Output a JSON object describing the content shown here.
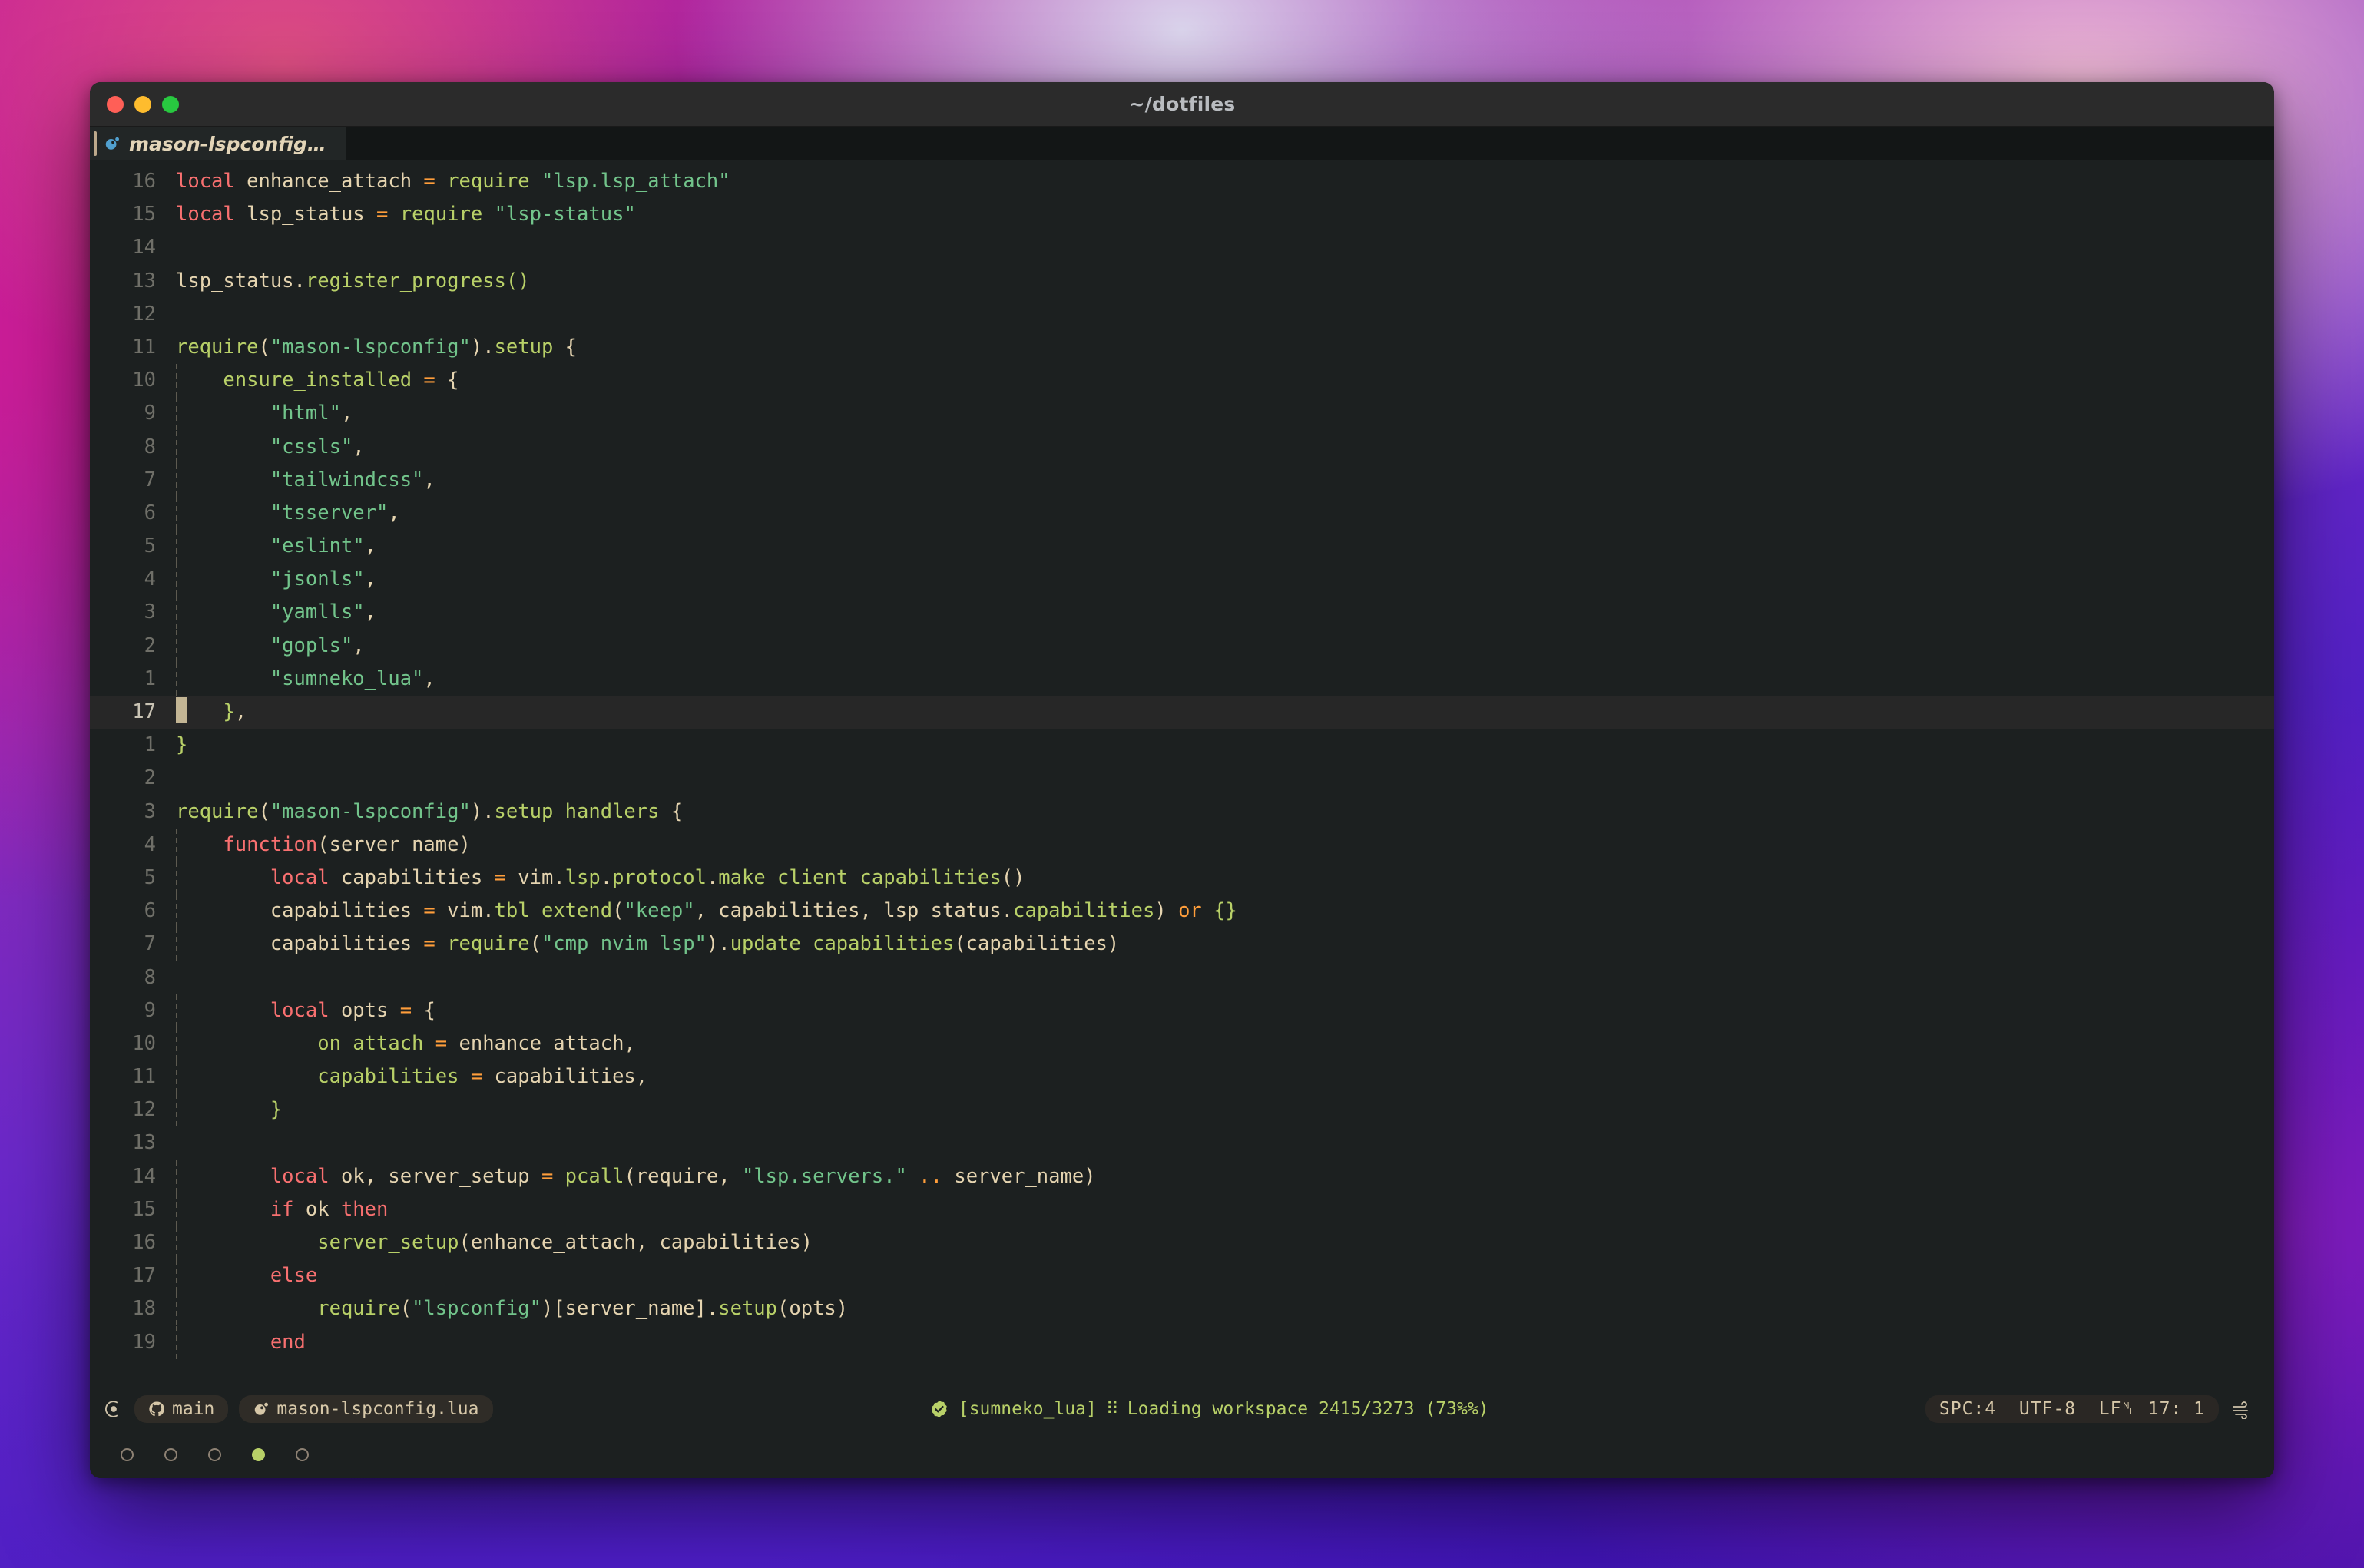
{
  "window": {
    "title": "~/dotfiles",
    "traffic_lights": [
      "close-button",
      "minimize-button",
      "zoom-button"
    ]
  },
  "tabline": {
    "tabs": [
      {
        "label": "mason-lspconfig…",
        "icon": "lua-icon",
        "active": true
      }
    ]
  },
  "editor": {
    "filetype": "lua",
    "cursor_line_number": "17",
    "lines": [
      {
        "num": "16",
        "indent": 0,
        "cursor": false,
        "tokens": [
          {
            "t": "local ",
            "c": "kw"
          },
          {
            "t": "enhance_attach ",
            "c": "var"
          },
          {
            "t": "= ",
            "c": "op"
          },
          {
            "t": "require ",
            "c": "fn"
          },
          {
            "t": "\"lsp.lsp_attach\"",
            "c": "str"
          }
        ]
      },
      {
        "num": "15",
        "indent": 0,
        "cursor": false,
        "tokens": [
          {
            "t": "local ",
            "c": "kw"
          },
          {
            "t": "lsp_status ",
            "c": "var"
          },
          {
            "t": "= ",
            "c": "op"
          },
          {
            "t": "require ",
            "c": "fn"
          },
          {
            "t": "\"lsp-status\"",
            "c": "str"
          }
        ]
      },
      {
        "num": "14",
        "indent": 0,
        "cursor": false,
        "tokens": []
      },
      {
        "num": "13",
        "indent": 0,
        "cursor": false,
        "tokens": [
          {
            "t": "lsp_status",
            "c": "var"
          },
          {
            "t": ".",
            "c": "pun"
          },
          {
            "t": "register_progress()",
            "c": "fn"
          }
        ]
      },
      {
        "num": "12",
        "indent": 0,
        "cursor": false,
        "tokens": []
      },
      {
        "num": "11",
        "indent": 0,
        "cursor": false,
        "tokens": [
          {
            "t": "require",
            "c": "fn"
          },
          {
            "t": "(",
            "c": "pun"
          },
          {
            "t": "\"mason-lspconfig\"",
            "c": "str"
          },
          {
            "t": ")",
            "c": "pun"
          },
          {
            "t": ".",
            "c": "pun"
          },
          {
            "t": "setup ",
            "c": "fn"
          },
          {
            "t": "{",
            "c": "pun"
          }
        ]
      },
      {
        "num": "10",
        "indent": 1,
        "cursor": false,
        "tokens": [
          {
            "t": "    ",
            "c": "pun"
          },
          {
            "t": "ensure_installed ",
            "c": "fn"
          },
          {
            "t": "= ",
            "c": "op"
          },
          {
            "t": "{",
            "c": "pun"
          }
        ]
      },
      {
        "num": "9",
        "indent": 2,
        "cursor": false,
        "tokens": [
          {
            "t": "        ",
            "c": "pun"
          },
          {
            "t": "\"html\"",
            "c": "str"
          },
          {
            "t": ",",
            "c": "pun"
          }
        ]
      },
      {
        "num": "8",
        "indent": 2,
        "cursor": false,
        "tokens": [
          {
            "t": "        ",
            "c": "pun"
          },
          {
            "t": "\"cssls\"",
            "c": "str"
          },
          {
            "t": ",",
            "c": "pun"
          }
        ]
      },
      {
        "num": "7",
        "indent": 2,
        "cursor": false,
        "tokens": [
          {
            "t": "        ",
            "c": "pun"
          },
          {
            "t": "\"tailwindcss\"",
            "c": "str"
          },
          {
            "t": ",",
            "c": "pun"
          }
        ]
      },
      {
        "num": "6",
        "indent": 2,
        "cursor": false,
        "tokens": [
          {
            "t": "        ",
            "c": "pun"
          },
          {
            "t": "\"tsserver\"",
            "c": "str"
          },
          {
            "t": ",",
            "c": "pun"
          }
        ]
      },
      {
        "num": "5",
        "indent": 2,
        "cursor": false,
        "tokens": [
          {
            "t": "        ",
            "c": "pun"
          },
          {
            "t": "\"eslint\"",
            "c": "str"
          },
          {
            "t": ",",
            "c": "pun"
          }
        ]
      },
      {
        "num": "4",
        "indent": 2,
        "cursor": false,
        "tokens": [
          {
            "t": "        ",
            "c": "pun"
          },
          {
            "t": "\"jsonls\"",
            "c": "str"
          },
          {
            "t": ",",
            "c": "pun"
          }
        ]
      },
      {
        "num": "3",
        "indent": 2,
        "cursor": false,
        "tokens": [
          {
            "t": "        ",
            "c": "pun"
          },
          {
            "t": "\"yamlls\"",
            "c": "str"
          },
          {
            "t": ",",
            "c": "pun"
          }
        ]
      },
      {
        "num": "2",
        "indent": 2,
        "cursor": false,
        "tokens": [
          {
            "t": "        ",
            "c": "pun"
          },
          {
            "t": "\"gopls\"",
            "c": "str"
          },
          {
            "t": ",",
            "c": "pun"
          }
        ]
      },
      {
        "num": "1",
        "indent": 2,
        "cursor": false,
        "tokens": [
          {
            "t": "        ",
            "c": "pun"
          },
          {
            "t": "\"sumneko_lua\"",
            "c": "str"
          },
          {
            "t": ",",
            "c": "pun"
          }
        ]
      },
      {
        "num": "17",
        "indent": 0,
        "cursor": true,
        "tokens": [
          {
            "t": "   ",
            "c": "pun"
          },
          {
            "t": "}",
            "c": "fn"
          },
          {
            "t": ",",
            "c": "pun"
          }
        ]
      },
      {
        "num": "1",
        "indent": 0,
        "cursor": false,
        "tokens": [
          {
            "t": "}",
            "c": "fn"
          }
        ]
      },
      {
        "num": "2",
        "indent": 0,
        "cursor": false,
        "tokens": []
      },
      {
        "num": "3",
        "indent": 0,
        "cursor": false,
        "tokens": [
          {
            "t": "require",
            "c": "fn"
          },
          {
            "t": "(",
            "c": "pun"
          },
          {
            "t": "\"mason-lspconfig\"",
            "c": "str"
          },
          {
            "t": ")",
            "c": "pun"
          },
          {
            "t": ".",
            "c": "pun"
          },
          {
            "t": "setup_handlers ",
            "c": "fn"
          },
          {
            "t": "{",
            "c": "pun"
          }
        ]
      },
      {
        "num": "4",
        "indent": 1,
        "cursor": false,
        "tokens": [
          {
            "t": "    ",
            "c": "pun"
          },
          {
            "t": "function",
            "c": "kw"
          },
          {
            "t": "(server_name)",
            "c": "var"
          }
        ]
      },
      {
        "num": "5",
        "indent": 2,
        "cursor": false,
        "tokens": [
          {
            "t": "        ",
            "c": "pun"
          },
          {
            "t": "local ",
            "c": "kw"
          },
          {
            "t": "capabilities ",
            "c": "var"
          },
          {
            "t": "= ",
            "c": "op"
          },
          {
            "t": "vim",
            "c": "var"
          },
          {
            "t": ".",
            "c": "pun"
          },
          {
            "t": "lsp",
            "c": "fn"
          },
          {
            "t": ".",
            "c": "pun"
          },
          {
            "t": "protocol",
            "c": "fn"
          },
          {
            "t": ".",
            "c": "pun"
          },
          {
            "t": "make_client_capabilities",
            "c": "fn"
          },
          {
            "t": "()",
            "c": "var"
          }
        ]
      },
      {
        "num": "6",
        "indent": 2,
        "cursor": false,
        "tokens": [
          {
            "t": "        ",
            "c": "pun"
          },
          {
            "t": "capabilities ",
            "c": "var"
          },
          {
            "t": "= ",
            "c": "op"
          },
          {
            "t": "vim",
            "c": "var"
          },
          {
            "t": ".",
            "c": "pun"
          },
          {
            "t": "tbl_extend",
            "c": "fn"
          },
          {
            "t": "(",
            "c": "var"
          },
          {
            "t": "\"keep\"",
            "c": "str"
          },
          {
            "t": ", capabilities, lsp_status",
            "c": "var"
          },
          {
            "t": ".",
            "c": "pun"
          },
          {
            "t": "capabilities",
            "c": "fn"
          },
          {
            "t": ") ",
            "c": "var"
          },
          {
            "t": "or ",
            "c": "op"
          },
          {
            "t": "{}",
            "c": "fn"
          }
        ]
      },
      {
        "num": "7",
        "indent": 2,
        "cursor": false,
        "tokens": [
          {
            "t": "        ",
            "c": "pun"
          },
          {
            "t": "capabilities ",
            "c": "var"
          },
          {
            "t": "= ",
            "c": "op"
          },
          {
            "t": "require",
            "c": "fn"
          },
          {
            "t": "(",
            "c": "var"
          },
          {
            "t": "\"cmp_nvim_lsp\"",
            "c": "str"
          },
          {
            "t": ")",
            "c": "var"
          },
          {
            "t": ".",
            "c": "pun"
          },
          {
            "t": "update_capabilities",
            "c": "fn"
          },
          {
            "t": "(capabilities)",
            "c": "var"
          }
        ]
      },
      {
        "num": "8",
        "indent": 2,
        "cursor": false,
        "tokens": []
      },
      {
        "num": "9",
        "indent": 2,
        "cursor": false,
        "tokens": [
          {
            "t": "        ",
            "c": "pun"
          },
          {
            "t": "local ",
            "c": "kw"
          },
          {
            "t": "opts ",
            "c": "var"
          },
          {
            "t": "= ",
            "c": "op"
          },
          {
            "t": "{",
            "c": "pun"
          }
        ]
      },
      {
        "num": "10",
        "indent": 3,
        "cursor": false,
        "tokens": [
          {
            "t": "            ",
            "c": "pun"
          },
          {
            "t": "on_attach ",
            "c": "fn"
          },
          {
            "t": "= ",
            "c": "op"
          },
          {
            "t": "enhance_attach",
            "c": "var"
          },
          {
            "t": ",",
            "c": "pun"
          }
        ]
      },
      {
        "num": "11",
        "indent": 3,
        "cursor": false,
        "tokens": [
          {
            "t": "            ",
            "c": "pun"
          },
          {
            "t": "capabilities ",
            "c": "fn"
          },
          {
            "t": "= ",
            "c": "op"
          },
          {
            "t": "capabilities",
            "c": "var"
          },
          {
            "t": ",",
            "c": "pun"
          }
        ]
      },
      {
        "num": "12",
        "indent": 2,
        "cursor": false,
        "tokens": [
          {
            "t": "        ",
            "c": "pun"
          },
          {
            "t": "}",
            "c": "fn"
          }
        ]
      },
      {
        "num": "13",
        "indent": 2,
        "cursor": false,
        "tokens": []
      },
      {
        "num": "14",
        "indent": 2,
        "cursor": false,
        "tokens": [
          {
            "t": "        ",
            "c": "pun"
          },
          {
            "t": "local ",
            "c": "kw"
          },
          {
            "t": "ok, server_setup ",
            "c": "var"
          },
          {
            "t": "= ",
            "c": "op"
          },
          {
            "t": "pcall",
            "c": "fn"
          },
          {
            "t": "(require, ",
            "c": "var"
          },
          {
            "t": "\"lsp.servers.\"",
            "c": "str"
          },
          {
            "t": " ",
            "c": "var"
          },
          {
            "t": "..",
            "c": "op"
          },
          {
            "t": " server_name)",
            "c": "var"
          }
        ]
      },
      {
        "num": "15",
        "indent": 2,
        "cursor": false,
        "tokens": [
          {
            "t": "        ",
            "c": "pun"
          },
          {
            "t": "if ",
            "c": "kw"
          },
          {
            "t": "ok ",
            "c": "var"
          },
          {
            "t": "then",
            "c": "kw"
          }
        ]
      },
      {
        "num": "16",
        "indent": 3,
        "cursor": false,
        "tokens": [
          {
            "t": "            ",
            "c": "pun"
          },
          {
            "t": "server_setup",
            "c": "fn"
          },
          {
            "t": "(enhance_attach, capabilities)",
            "c": "var"
          }
        ]
      },
      {
        "num": "17",
        "indent": 2,
        "cursor": false,
        "tokens": [
          {
            "t": "        ",
            "c": "pun"
          },
          {
            "t": "else",
            "c": "kw"
          }
        ]
      },
      {
        "num": "18",
        "indent": 3,
        "cursor": false,
        "tokens": [
          {
            "t": "            ",
            "c": "pun"
          },
          {
            "t": "require",
            "c": "fn"
          },
          {
            "t": "(",
            "c": "var"
          },
          {
            "t": "\"lspconfig\"",
            "c": "str"
          },
          {
            "t": ")[server_name]",
            "c": "var"
          },
          {
            "t": ".",
            "c": "pun"
          },
          {
            "t": "setup",
            "c": "fn"
          },
          {
            "t": "(opts)",
            "c": "var"
          }
        ]
      },
      {
        "num": "19",
        "indent": 2,
        "cursor": false,
        "tokens": [
          {
            "t": "        ",
            "c": "pun"
          },
          {
            "t": "end",
            "c": "kw"
          }
        ]
      }
    ]
  },
  "statusline": {
    "mode_icon": "record-icon",
    "git_branch": "main",
    "git_icon": "github-icon",
    "filename": "mason-lspconfig.lua",
    "file_icon": "lua-icon",
    "lsp_status_icon": "check-circle-icon",
    "lsp_client": "[sumneko_lua]",
    "lsp_spinner": "⠿",
    "lsp_message": "Loading workspace 2415/3273 (73%%)",
    "indent": "SPC:4",
    "encoding": "UTF-8",
    "line_ending": "LF",
    "line_ending_glyph": "␤",
    "position": "17: 1",
    "weather_icon": "wind-icon"
  },
  "workspaces": {
    "dots": [
      {
        "active": false
      },
      {
        "active": false
      },
      {
        "active": false
      },
      {
        "active": true
      },
      {
        "active": false
      }
    ]
  },
  "colors": {
    "editor_bg": "#1c2020",
    "cursorline_bg": "#272727",
    "titlebar_bg": "#2b2b2b",
    "keyword": "#f87070",
    "operator": "#ff9e3b",
    "string": "#72c48b",
    "function": "#b8d068",
    "variable": "#e5d4b0",
    "linenr": "#6f6f68",
    "accent": "#b8d068"
  }
}
